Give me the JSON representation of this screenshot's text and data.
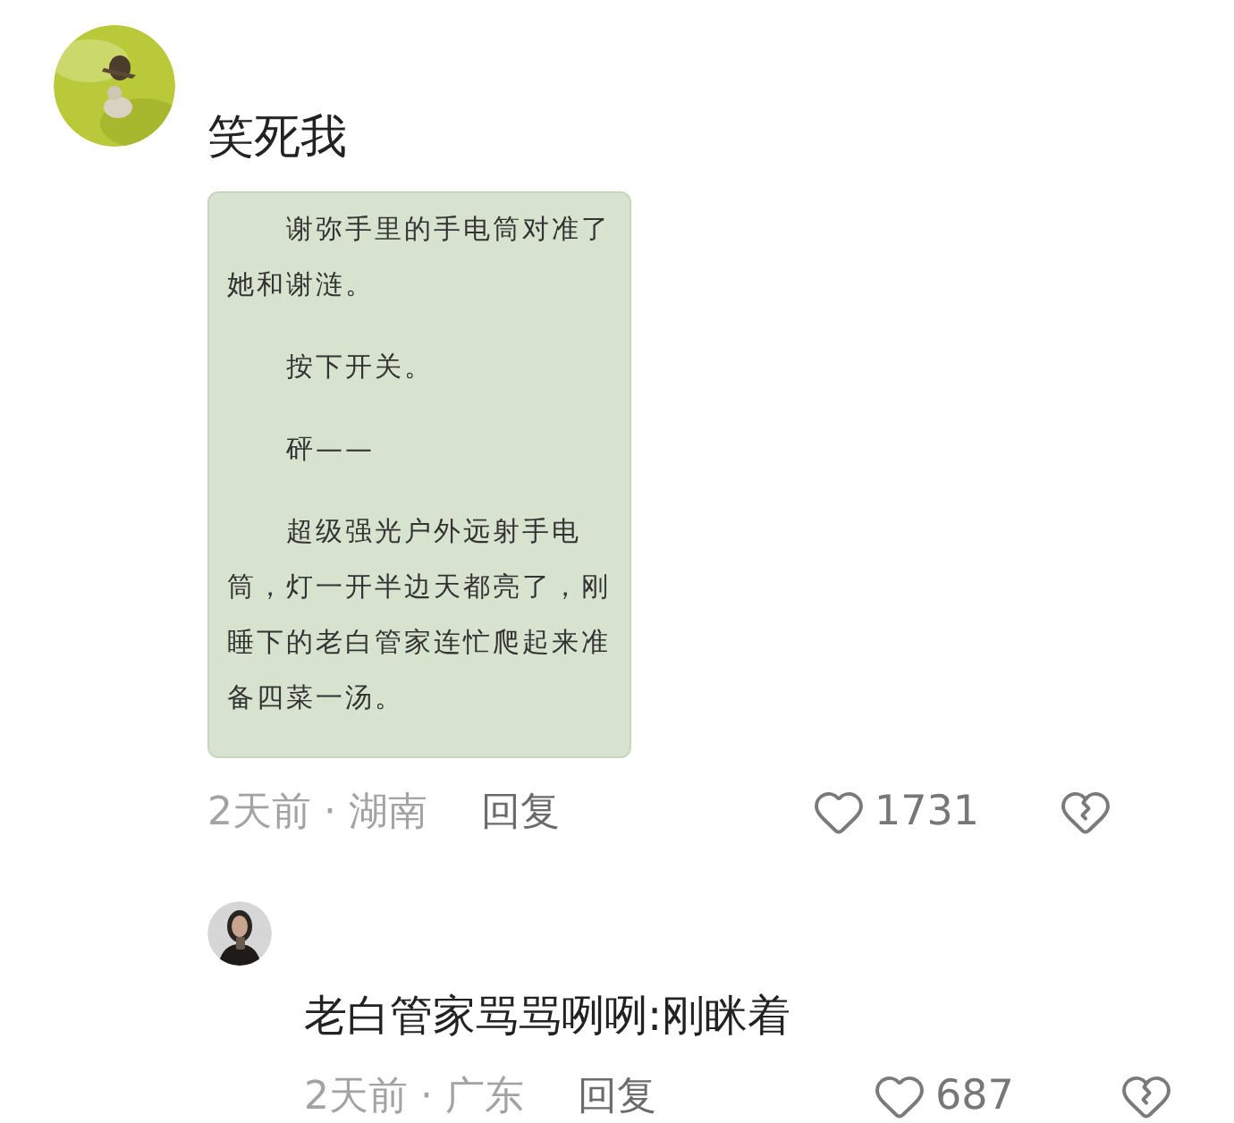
{
  "comment": {
    "text": "笑死我",
    "attachment": {
      "paragraphs": [
        "谢弥手里的手电筒对准了她和谢涟。",
        "按下开关。",
        "砰——",
        "超级强光户外远射手电筒，灯一开半边天都亮了，刚睡下的老白管家连忙爬起来准备四菜一汤。"
      ]
    },
    "time": "2天前 · 湖南",
    "reply_label": "回复",
    "likes": "1731"
  },
  "reply": {
    "text": "老白管家骂骂咧咧:刚眯着",
    "time": "2天前 · 广东",
    "reply_label": "回复",
    "likes": "687"
  }
}
